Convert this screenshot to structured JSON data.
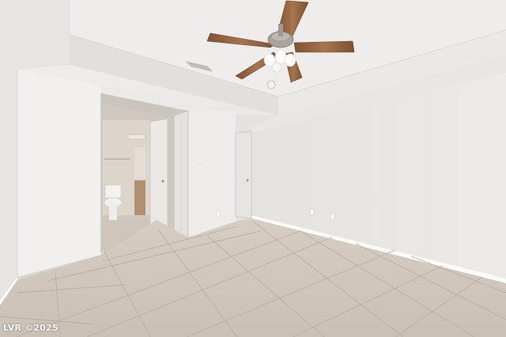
{
  "watermark": {
    "text": "LVR ©2025"
  },
  "palette": {
    "ceiling": "#f1f0ee",
    "wall_left": "#efeeec",
    "wall_right": "#e8e6e3",
    "floor_tile": "#cdc3b9",
    "grout": "#b8ada2",
    "door": "#e9e7e3",
    "fan_blade": "#9c6a45"
  }
}
